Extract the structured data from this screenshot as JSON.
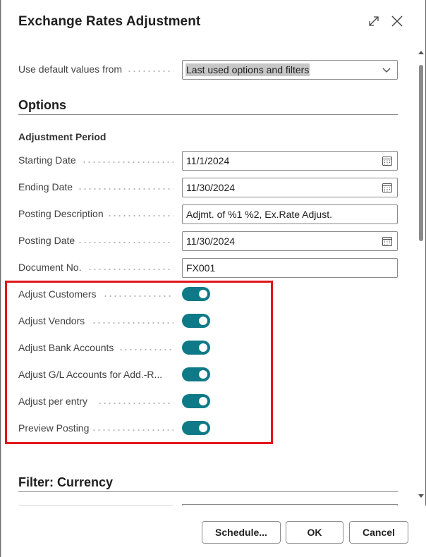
{
  "dialog": {
    "title": "Exchange Rates Adjustment",
    "icons": {
      "expand": "expand-icon",
      "close": "close-icon"
    }
  },
  "default_values": {
    "label": "Use default values from",
    "value": "Last used options and filters"
  },
  "options": {
    "title": "Options",
    "adjustment_period": "Adjustment Period",
    "fields": {
      "starting_date": {
        "label": "Starting Date",
        "value": "11/1/2024"
      },
      "ending_date": {
        "label": "Ending Date",
        "value": "11/30/2024"
      },
      "posting_description": {
        "label": "Posting Description",
        "value": "Adjmt. of %1 %2, Ex.Rate Adjust."
      },
      "posting_date": {
        "label": "Posting Date",
        "value": "11/30/2024"
      },
      "document_no": {
        "label": "Document No.",
        "value": "FX001"
      }
    },
    "toggles": [
      {
        "label": "Adjust Customers",
        "on": true
      },
      {
        "label": "Adjust Vendors",
        "on": true
      },
      {
        "label": "Adjust Bank Accounts",
        "on": true
      },
      {
        "label": "Adjust G/L Accounts for Add.-R...",
        "on": true
      },
      {
        "label": "Adjust per entry",
        "on": true
      },
      {
        "label": "Preview Posting",
        "on": true
      }
    ]
  },
  "filter": {
    "title": "Filter: Currency"
  },
  "footer": {
    "schedule": "Schedule...",
    "ok": "OK",
    "cancel": "Cancel"
  },
  "colors": {
    "toggle_on": "#0f7a87",
    "highlight": "#e3141b"
  }
}
